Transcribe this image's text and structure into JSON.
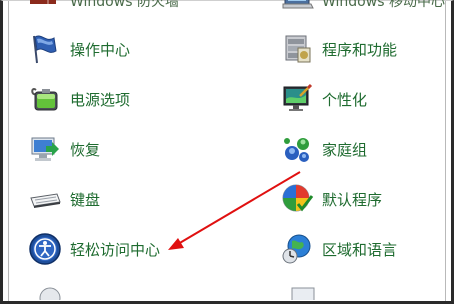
{
  "left_column": [
    {
      "label": "Windows 防火墙",
      "icon": "firewall-icon",
      "partial": true
    },
    {
      "label": "操作中心",
      "icon": "action-center-flag-icon"
    },
    {
      "label": "电源选项",
      "icon": "power-options-battery-icon"
    },
    {
      "label": "恢复",
      "icon": "recovery-computer-icon"
    },
    {
      "label": "键盘",
      "icon": "keyboard-icon"
    },
    {
      "label": "轻松访问中心",
      "icon": "ease-of-access-icon"
    }
  ],
  "right_column": [
    {
      "label": "Windows 移动中心",
      "icon": "mobility-center-icon",
      "partial": true
    },
    {
      "label": "程序和功能",
      "icon": "programs-features-icon"
    },
    {
      "label": "个性化",
      "icon": "personalization-monitor-icon"
    },
    {
      "label": "家庭组",
      "icon": "homegroup-icon"
    },
    {
      "label": "默认程序",
      "icon": "default-programs-icon"
    },
    {
      "label": "区域和语言",
      "icon": "region-language-globe-icon"
    }
  ],
  "colors": {
    "link_text": "#1e6b2f",
    "annotation_arrow": "#e01010"
  }
}
